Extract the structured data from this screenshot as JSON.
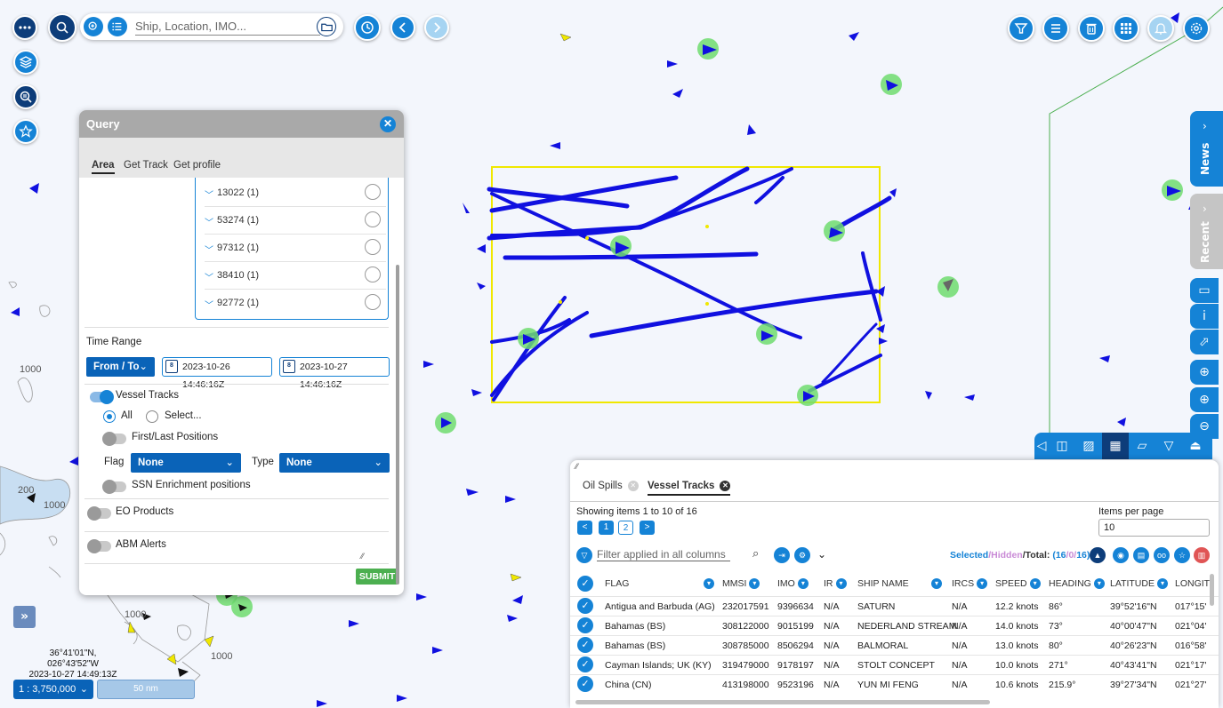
{
  "search": {
    "placeholder": "Ship, Location, IMO..."
  },
  "query": {
    "title": "Query",
    "tabs": [
      "Area",
      "Get Track",
      "Get profile"
    ],
    "ids": [
      "13022 (1)",
      "53274 (1)",
      "97312 (1)",
      "38410 (1)",
      "92772 (1)"
    ],
    "time_range_label": "Time Range",
    "range_mode": "From / To",
    "date_from": "2023-10-26 14:46:16Z",
    "date_to": "2023-10-27 14:46:16Z",
    "vessel_tracks": "Vessel Tracks",
    "opt_all": "All",
    "opt_select": "Select...",
    "first_last": "First/Last Positions",
    "flag_label": "Flag",
    "flag_value": "None",
    "type_label": "Type",
    "type_value": "None",
    "ssn": "SSN Enrichment positions",
    "eo": "EO Products",
    "abm": "ABM Alerts",
    "submit": "SUBMIT"
  },
  "side": {
    "news": "News",
    "recent": "Recent"
  },
  "map": {
    "coords": "36°41'01\"N, 026°43'52\"W",
    "time": "2023-10-27 14:49:13Z",
    "scale": "1 : 3,750,000",
    "scale_bar": "50 nm",
    "depth_labels": [
      "1000",
      "1000",
      "1000",
      "200",
      "1000"
    ]
  },
  "table": {
    "tabs": [
      "Oil Spills",
      "Vessel Tracks"
    ],
    "showing": "Showing items 1 to 10 of 16",
    "pages": [
      "<",
      "1",
      "2",
      ">"
    ],
    "items_per_page_label": "Items per page",
    "items_per_page": "10",
    "filter_placeholder": "Filter applied in all columns",
    "sel_selected": "Selected",
    "sel_hidden": "/Hidden",
    "sel_total": "/Total:",
    "count_a": "(16",
    "count_b": "/0/",
    "count_c": "16)",
    "columns": [
      "FLAG",
      "MMSI",
      "IMO",
      "IR",
      "SHIP NAME",
      "IRCS",
      "SPEED",
      "HEADING",
      "LATITUDE",
      "LONGIT"
    ],
    "rows": [
      [
        "Antigua and Barbuda (AG)",
        "232017591",
        "9396634",
        "N/A",
        "SATURN",
        "N/A",
        "12.2 knots",
        "86°",
        "39°52'16\"N",
        "017°15'"
      ],
      [
        "Bahamas (BS)",
        "308122000",
        "9015199",
        "N/A",
        "NEDERLAND STREAM",
        "N/A",
        "14.0 knots",
        "73°",
        "40°00'47\"N",
        "021°04'"
      ],
      [
        "Bahamas (BS)",
        "308785000",
        "8506294",
        "N/A",
        "BALMORAL",
        "N/A",
        "13.0 knots",
        "80°",
        "40°26'23\"N",
        "016°58'"
      ],
      [
        "Cayman Islands; UK (KY)",
        "319479000",
        "9178197",
        "N/A",
        "STOLT CONCEPT",
        "N/A",
        "10.0 knots",
        "271°",
        "40°43'41\"N",
        "021°17'"
      ],
      [
        "China (CN)",
        "413198000",
        "9523196",
        "N/A",
        "YUN MI FENG",
        "N/A",
        "10.6 knots",
        "215.9°",
        "39°27'34\"N",
        "021°27'"
      ]
    ]
  },
  "colors": {
    "accent": "#1583d6",
    "dark": "#0d3d7a",
    "track": "#1010e0",
    "area": "#f0e800",
    "target": "#6fdc6f",
    "submit": "#4caf50"
  }
}
